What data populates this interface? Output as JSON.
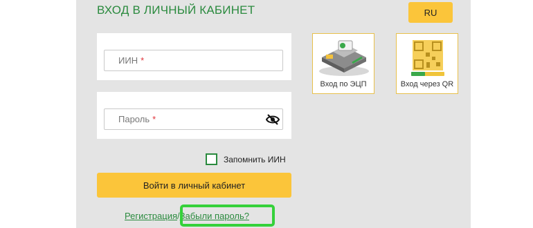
{
  "header": {
    "title": "ВХОД В ЛИЧНЫЙ КАБИНЕТ",
    "lang_label": "RU"
  },
  "form": {
    "iin_placeholder": "ИИН",
    "password_placeholder": "Пароль",
    "required_mark": "*",
    "remember_label": "Запомнить ИИН",
    "remember_checked": false,
    "submit_label": "Войти в личный кабинет"
  },
  "login_options": [
    {
      "label": "Вход по ЭЦП",
      "icon": "digital-signature-icon"
    },
    {
      "label": "Вход через QR",
      "icon": "qr-code-icon"
    }
  ],
  "links": {
    "register": "Регистрация",
    "separator": "/",
    "forgot": "Забыли пароль?"
  },
  "colors": {
    "accent_green": "#2a8a3e",
    "button_yellow": "#fbc53a",
    "highlight_green": "#35d13a"
  }
}
